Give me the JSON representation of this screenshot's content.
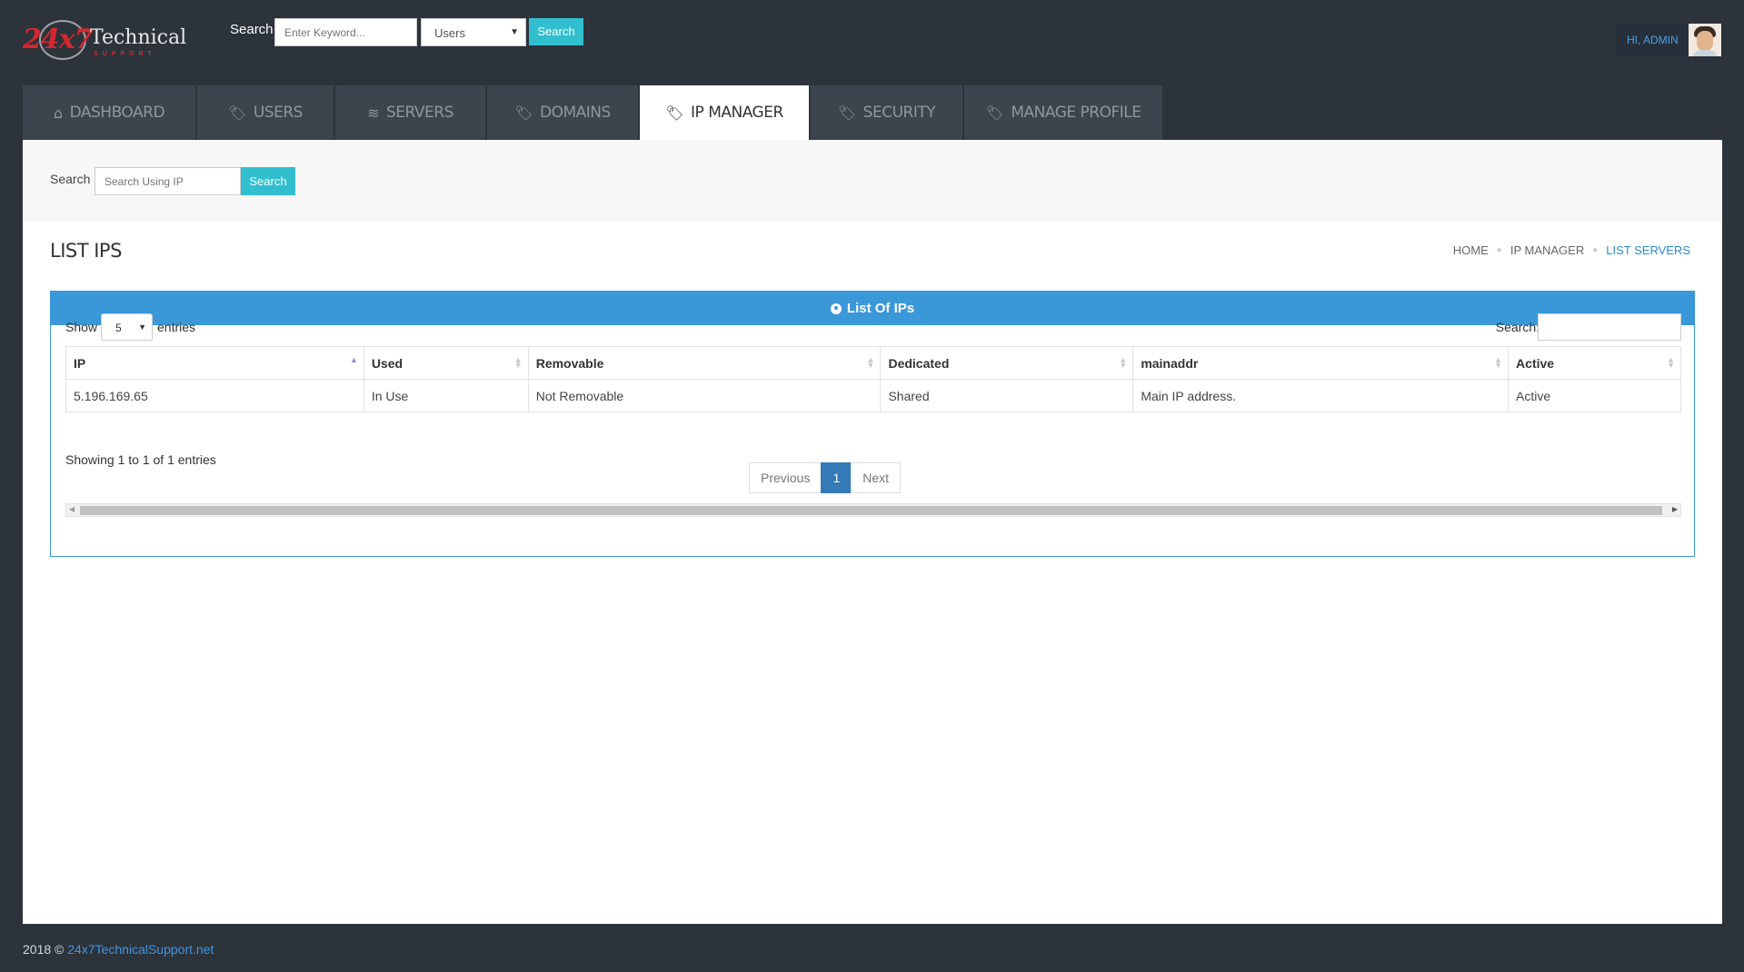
{
  "header": {
    "logo": {
      "number": "24x7",
      "word": "Technical",
      "sub": "SUPPORT"
    },
    "search_label": "Search",
    "search_placeholder": "Enter Keyword...",
    "search_scope": "Users",
    "search_button": "Search",
    "user_greeting": "HI, ADMIN"
  },
  "nav": {
    "tabs": [
      {
        "label": "DASHBOARD",
        "icon": "home-icon"
      },
      {
        "label": "USERS",
        "icon": "tag-icon"
      },
      {
        "label": "SERVERS",
        "icon": "layers-icon"
      },
      {
        "label": "DOMAINS",
        "icon": "tag-icon"
      },
      {
        "label": "IP MANAGER",
        "icon": "tag-icon",
        "active": true
      },
      {
        "label": "SECURITY",
        "icon": "tag-icon"
      },
      {
        "label": "MANAGE PROFILE",
        "icon": "tag-icon"
      }
    ]
  },
  "subbar": {
    "search_label": "Search",
    "search_placeholder": "Search Using IP",
    "search_button": "Search"
  },
  "page": {
    "title": "LIST IPS",
    "breadcrumb": [
      "HOME",
      "IP MANAGER",
      "LIST SERVERS"
    ]
  },
  "card": {
    "title": "List Of IPs",
    "show_label": "Show",
    "entries_length": "5",
    "entries_label": "entries",
    "search_label": "Search:",
    "columns": [
      "IP",
      "Used",
      "Removable",
      "Dedicated",
      "mainaddr",
      "Active"
    ],
    "rows": [
      [
        "5.196.169.65",
        "In Use",
        "Not Removable",
        "Shared",
        "Main IP address.",
        "Active"
      ]
    ],
    "info": "Showing 1 to 1 of 1 entries",
    "pagination": {
      "previous": "Previous",
      "current": "1",
      "next": "Next"
    }
  },
  "footer": {
    "text": "2018 ©",
    "link": "24x7TechnicalSupport.net"
  },
  "colors": {
    "background": "#2d333b",
    "accent_button": "#31bfcf",
    "card_header": "#3a98d8",
    "active_page": "#337ab7",
    "logo_red": "#d9262c"
  }
}
